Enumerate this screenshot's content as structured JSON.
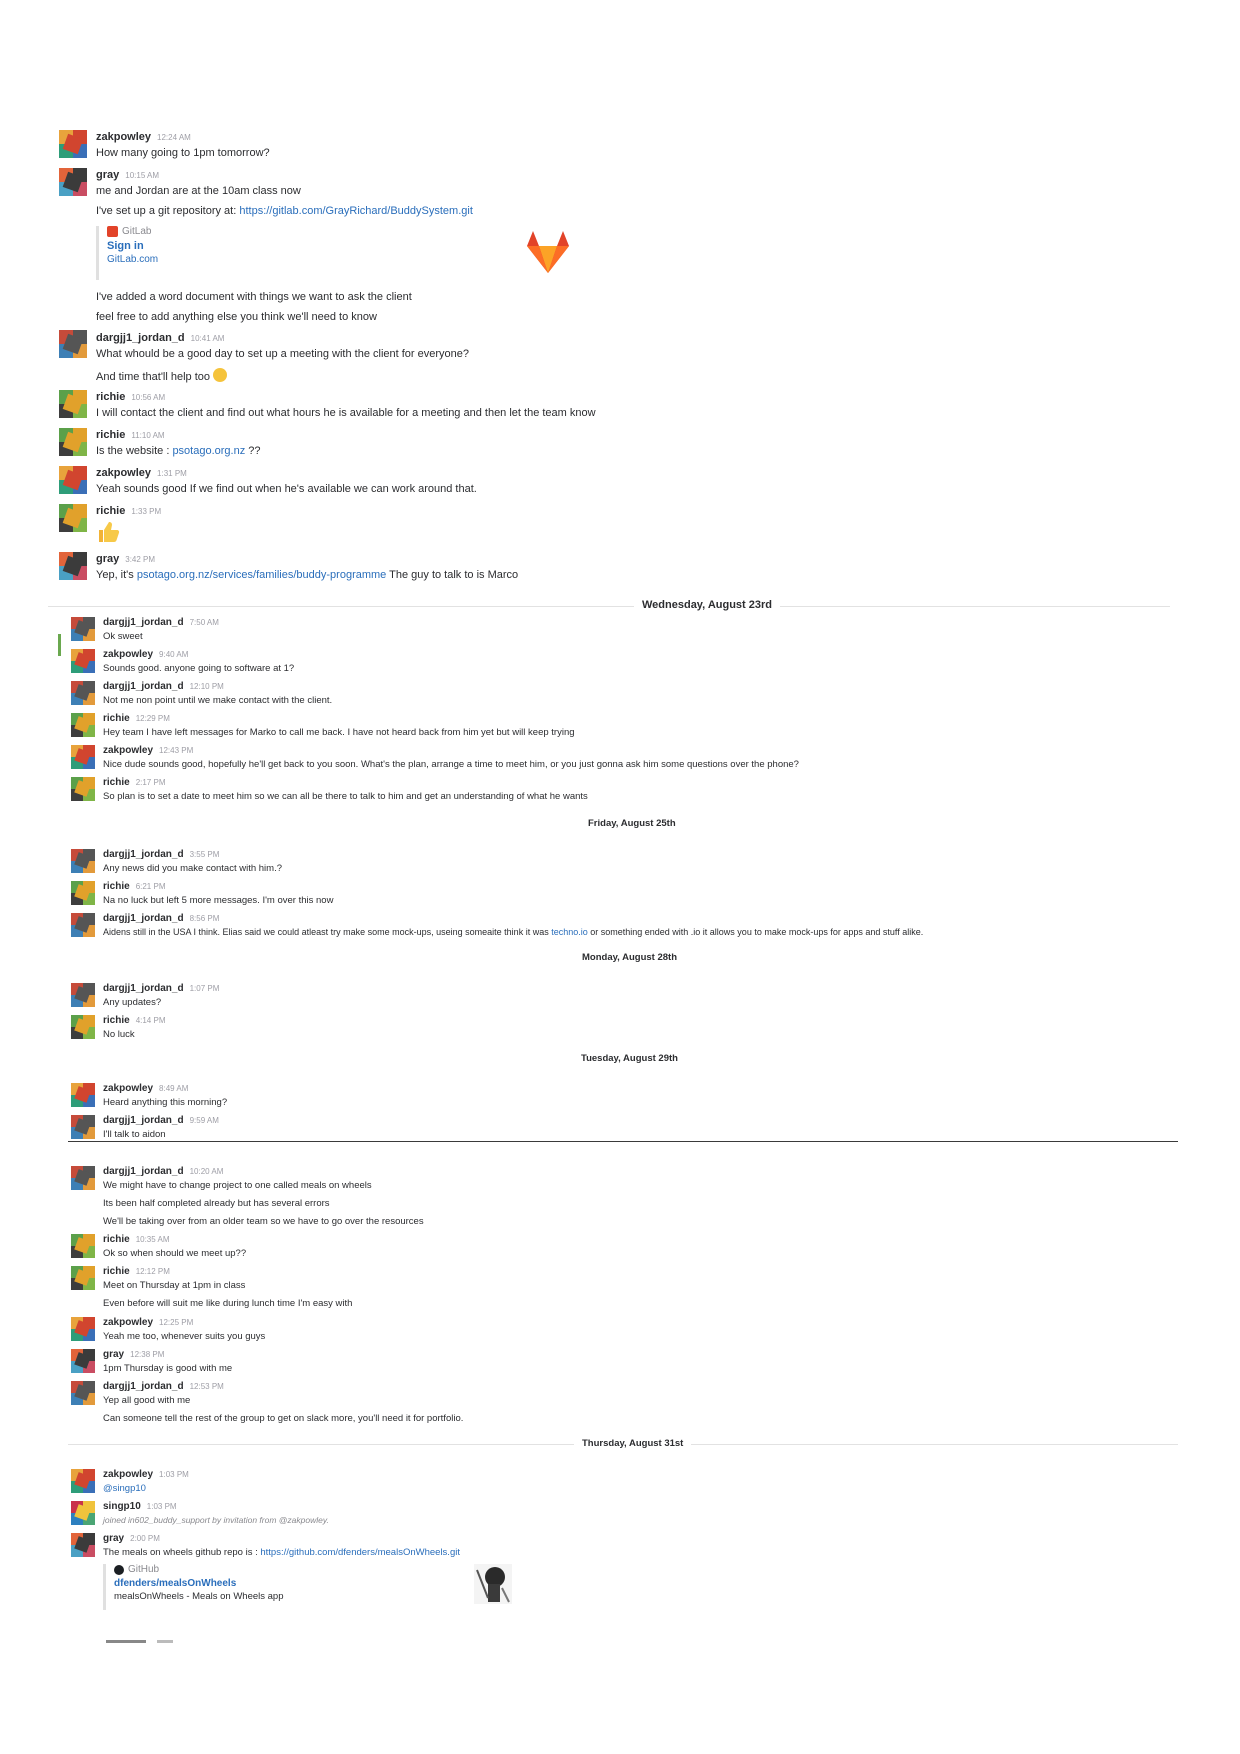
{
  "colors": {
    "link": "#2a6ebb",
    "text": "#2c2d30",
    "timestamp": "#9e9ea6",
    "divider": "#e2e2e2",
    "gitlab_orange": "#e24329"
  },
  "section1": {
    "messages": [
      {
        "user": "zakpowley",
        "time": "12:24 AM",
        "lines": [
          "How many going to 1pm tomorrow?"
        ]
      },
      {
        "user": "gray",
        "time": "10:15 AM",
        "lines": [
          "me and Jordan are at the 10am class now"
        ]
      },
      {
        "line_prefix": "I've set up a git repository at: ",
        "link": "https://gitlab.com/GrayRichard/BuddySystem.git"
      },
      {
        "attachment": {
          "service": "GitLab",
          "title": "Sign in",
          "text": "GitLab.com"
        }
      },
      {
        "lines": [
          "I've added a word document with things we want to ask the client",
          "feel free to add anything else you think we'll need to know"
        ]
      },
      {
        "user": "dargjj1_jordan_d",
        "time": "10:41 AM",
        "lines": [
          "What whould be a good day to set up a meeting with the client for everyone?",
          "And time that'll help too"
        ]
      },
      {
        "user": "richie",
        "time": "10:56 AM",
        "lines": [
          "I will contact the client and find out what hours he is available for a meeting and then let the team know"
        ]
      },
      {
        "user": "richie",
        "time": "11:10 AM",
        "line_prefix": "Is the website : ",
        "link": "psotago.org.nz",
        "line_suffix": " ??"
      },
      {
        "user": "zakpowley",
        "time": "1:31 PM",
        "lines": [
          "Yeah sounds good If we find out when he's available we can work around that."
        ]
      },
      {
        "user": "richie",
        "time": "1:33 PM"
      },
      {
        "user": "gray",
        "time": "3:42 PM",
        "line_prefix": "Yep, it's ",
        "link": "psotago.org.nz/services/families/buddy-programme",
        "line_suffix": " The guy to talk to is Marco"
      }
    ]
  },
  "day1": "Wednesday, August 23rd",
  "section2": [
    {
      "user": "dargjj1_jordan_d",
      "time": "7:50 AM",
      "text": "Ok sweet"
    },
    {
      "user": "zakpowley",
      "time": "9:40 AM",
      "text": "Sounds good. anyone going to software at 1?"
    },
    {
      "user": "dargjj1_jordan_d",
      "time": "12:10 PM",
      "text": "Not me non point until we make contact with the client."
    },
    {
      "user": "richie",
      "time": "12:29 PM",
      "text": "Hey team I have left messages for Marko to call me back. I have not heard back from him yet but will keep trying"
    },
    {
      "user": "zakpowley",
      "time": "12:43 PM",
      "text": "Nice dude sounds good, hopefully he'll get back to you soon. What's the plan, arrange a time to meet him, or you just gonna ask him some questions over the phone?"
    },
    {
      "user": "richie",
      "time": "2:17 PM",
      "text": "So plan is to set a date to meet him so we can all be there to talk to him and get an understanding of what he wants"
    }
  ],
  "day2": "Friday, August 25th",
  "section3": [
    {
      "user": "dargjj1_jordan_d",
      "time": "3:55 PM",
      "text": "Any news did you make contact with him.?"
    },
    {
      "user": "richie",
      "time": "6:21 PM",
      "text": "Na no luck but left 5 more messages. I'm over this now"
    },
    {
      "user": "dargjj1_jordan_d",
      "time": "8:56 PM",
      "text_prefix": "Aidens still in the USA I think. Elias said we could atleast try make some mock-ups, useing someaite think it was ",
      "link": "techno.io",
      "text_suffix": " or something ended with .io it allows you to make mock-ups for apps and stuff alike."
    }
  ],
  "day3": "Monday, August 28th",
  "section4": [
    {
      "user": "dargjj1_jordan_d",
      "time": "1:07 PM",
      "text": "Any updates?"
    },
    {
      "user": "richie",
      "time": "4:14 PM",
      "text": "No luck"
    }
  ],
  "day4": "Tuesday, August 29th",
  "section5": [
    {
      "user": "zakpowley",
      "time": "8:49 AM",
      "text": "Heard anything this morning?"
    },
    {
      "user": "dargjj1_jordan_d",
      "time": "9:59 AM",
      "text": "I'll talk to aidon"
    }
  ],
  "section6": [
    {
      "user": "dargjj1_jordan_d",
      "time": "10:20 AM",
      "lines": [
        "We might have to change project to one called meals on wheels",
        "Its been half completed already but has several errors",
        "We'll be taking over from an older team so we have to go over the resources"
      ]
    },
    {
      "user": "richie",
      "time": "10:35 AM",
      "lines": [
        "Ok so when should we meet up??"
      ]
    },
    {
      "user": "richie",
      "time": "12:12 PM",
      "lines": [
        "Meet on Thursday at 1pm in class",
        "Even before will suit me like during lunch time I'm easy with"
      ]
    },
    {
      "user": "zakpowley",
      "time": "12:25 PM",
      "lines": [
        "Yeah me too, whenever suits you guys"
      ]
    },
    {
      "user": "gray",
      "time": "12:38 PM",
      "lines": [
        "1pm Thursday is good with me"
      ]
    },
    {
      "user": "dargjj1_jordan_d",
      "time": "12:53 PM",
      "lines": [
        "Yep all good with me",
        "Can someone tell the rest of the group to get on slack more, you'll need it for portfolio."
      ]
    }
  ],
  "day5": "Thursday, August 31st",
  "section7": [
    {
      "user": "zakpowley",
      "time": "1:03 PM",
      "mention": "@singp10"
    },
    {
      "user": "singp10",
      "time": "1:03 PM",
      "system": "joined in602_buddy_support by invitation from @zakpowley."
    },
    {
      "user": "gray",
      "time": "2:00 PM",
      "text_prefix": "The meals on wheels github repo is : ",
      "link": "https://github.com/dfenders/mealsOnWheels.git"
    }
  ],
  "github_attachment": {
    "service": "GitHub",
    "title": "dfenders/mealsOnWheels",
    "desc": "mealsOnWheels - Meals on Wheels app"
  }
}
